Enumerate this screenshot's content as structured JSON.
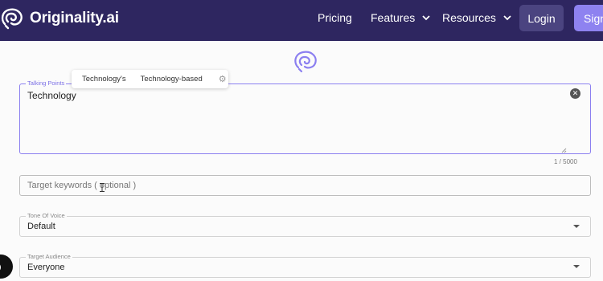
{
  "nav": {
    "brand": "Originality.ai",
    "links": [
      {
        "label": "Pricing",
        "has_dropdown": false
      },
      {
        "label": "Features",
        "has_dropdown": true
      },
      {
        "label": "Resources",
        "has_dropdown": true
      }
    ],
    "login_label": "Login",
    "signup_label": "Sign",
    "colors": {
      "bar": "#2e2660",
      "login_bg": "#4b4480",
      "signup_bg": "#8e82f0"
    }
  },
  "form": {
    "talking_points": {
      "label": "Talking Points",
      "value": "Technology",
      "counter": "1 / 5000"
    },
    "suggestions": [
      "Technology's",
      "Technology-based"
    ],
    "target_keywords": {
      "placeholder": "Target keywords ( optional )"
    },
    "tone_of_voice": {
      "label": "Tone Of Voice",
      "value": "Default"
    },
    "target_audience": {
      "label": "Target Audience",
      "value": "Everyone"
    },
    "accent_color": "#8b7ff0"
  }
}
